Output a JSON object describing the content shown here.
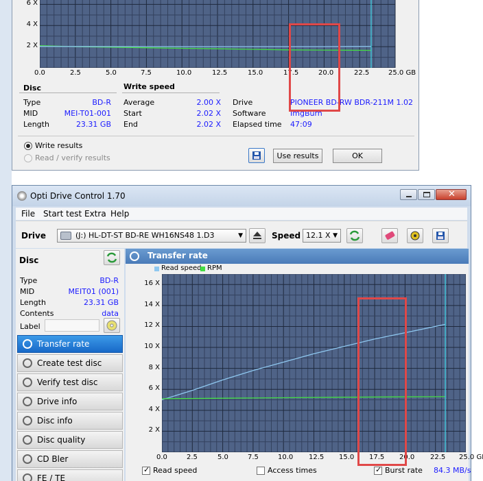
{
  "top_window": {
    "y_ticks": [
      "6 X",
      "4 X",
      "2 X"
    ],
    "x_ticks": [
      "0.0",
      "2.5",
      "5.0",
      "7.5",
      "10.0",
      "12.5",
      "15.0",
      "17.5",
      "20.0",
      "22.5",
      "25.0 GB"
    ],
    "disc": {
      "heading": "Disc",
      "rows": [
        {
          "label": "Type",
          "value": "BD-R"
        },
        {
          "label": "MID",
          "value": "MEI-T01-001"
        },
        {
          "label": "Length",
          "value": "23.31 GB"
        }
      ]
    },
    "write_speed": {
      "heading": "Write speed",
      "rows": [
        {
          "label": "Average",
          "value": "2.00 X"
        },
        {
          "label": "Start",
          "value": "2.02 X"
        },
        {
          "label": "End",
          "value": "2.02 X"
        }
      ]
    },
    "info": {
      "drive_label": "Drive",
      "drive_value": "PIONEER  BD-RW   BDR-211M 1.02",
      "software_label": "Software",
      "software_value": "ImgBurn",
      "elapsed_label": "Elapsed time",
      "elapsed_value": "47:09"
    },
    "radio_write": "Write results",
    "radio_read": "Read / verify results",
    "use_results": "Use results",
    "ok": "OK"
  },
  "main_window": {
    "title": "Opti Drive Control 1.70",
    "menu": [
      "File",
      "Start test",
      "Extra",
      "Help"
    ],
    "toolbar": {
      "drive_label": "Drive",
      "drive_value": "(J:)   HL-DT-ST BD-RE  WH16NS48 1.D3",
      "speed_label": "Speed",
      "speed_value": "12.1 X"
    },
    "disc_panel": {
      "heading": "Disc",
      "rows": [
        {
          "label": "Type",
          "value": "BD-R"
        },
        {
          "label": "MID",
          "value": "MEIT01 (001)"
        },
        {
          "label": "Length",
          "value": "23.31 GB"
        },
        {
          "label": "Contents",
          "value": "data"
        }
      ],
      "label_field": "Label"
    },
    "nav": [
      "Transfer rate",
      "Create test disc",
      "Verify test disc",
      "Drive info",
      "Disc info",
      "Disc quality",
      "CD Bler",
      "FE / TE"
    ],
    "panel_title": "Transfer rate",
    "legend_read": "Read speed",
    "legend_rpm": "RPM",
    "y_ticks": [
      "16 X",
      "14 X",
      "12 X",
      "10 X",
      "8 X",
      "6 X",
      "4 X",
      "2 X"
    ],
    "x_ticks": [
      "0.0",
      "2.5",
      "5.0",
      "7.5",
      "10.0",
      "12.5",
      "15.0",
      "17.5",
      "20.0",
      "22.5",
      "25.0 GB"
    ],
    "bottom": {
      "read_speed": "Read speed",
      "access_times": "Access times",
      "burst_rate": "Burst rate",
      "burst_value": "84.3 MB/s"
    }
  },
  "colors": {
    "plot_bg": "#4f6387",
    "grid": "#2a3550",
    "read_line": "#8fc8f0",
    "rpm_line": "#44dd44",
    "highlight": "#e04848"
  },
  "chart_data": [
    {
      "type": "line",
      "title": "",
      "xlabel": "",
      "ylabel": "",
      "xlim": [
        0,
        25
      ],
      "ylim": [
        0,
        7
      ],
      "series": [
        {
          "values": [
            [
              0,
              2.1
            ],
            [
              2.5,
              2.0
            ],
            [
              5,
              1.95
            ],
            [
              7.5,
              1.9
            ],
            [
              10,
              1.85
            ],
            [
              12.5,
              1.8
            ],
            [
              15,
              1.75
            ],
            [
              17.5,
              1.7
            ],
            [
              20,
              1.68
            ],
            [
              23.3,
              1.65
            ]
          ]
        },
        {
          "values": [
            [
              0,
              2.02
            ],
            [
              5,
              2.01
            ],
            [
              10,
              2.0
            ],
            [
              15,
              2.0
            ],
            [
              20,
              2.0
            ],
            [
              23.3,
              2.02
            ]
          ]
        }
      ]
    },
    {
      "type": "line",
      "title": "",
      "xlabel": "",
      "ylabel": "",
      "xlim": [
        0,
        25
      ],
      "ylim": [
        0,
        17
      ],
      "series": [
        {
          "name": "Read speed",
          "values": [
            [
              0,
              5.0
            ],
            [
              2.5,
              5.9
            ],
            [
              5,
              6.9
            ],
            [
              7.5,
              7.8
            ],
            [
              10,
              8.6
            ],
            [
              12.5,
              9.4
            ],
            [
              15,
              10.1
            ],
            [
              17.5,
              10.8
            ],
            [
              20,
              11.4
            ],
            [
              23.3,
              12.2
            ]
          ]
        },
        {
          "name": "RPM",
          "values": [
            [
              0,
              5.1
            ],
            [
              5,
              5.15
            ],
            [
              10,
              5.2
            ],
            [
              15,
              5.25
            ],
            [
              20,
              5.28
            ],
            [
              23.3,
              5.3
            ]
          ]
        }
      ]
    }
  ]
}
